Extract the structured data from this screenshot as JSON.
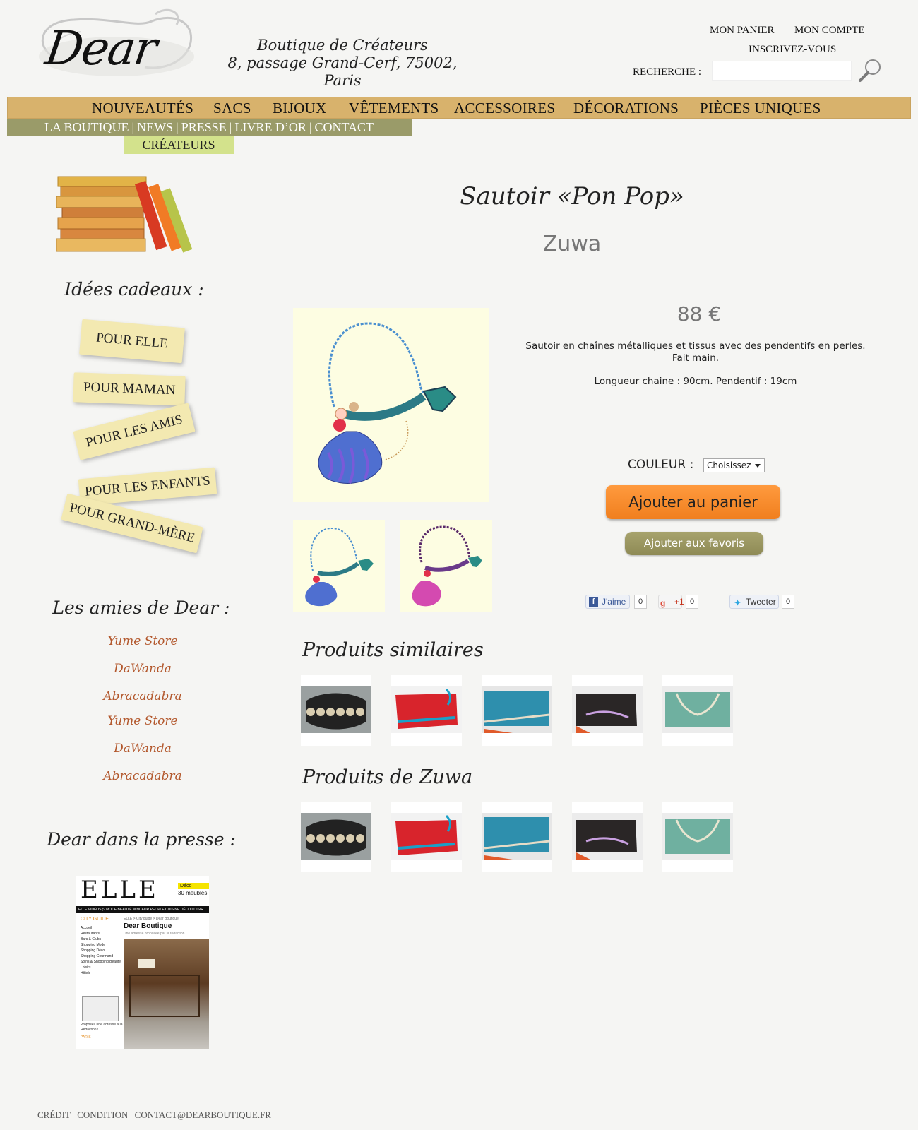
{
  "header": {
    "logo_text": "Dear",
    "tagline_1": "Boutique de Créateurs",
    "tagline_2": "8, passage Grand-Cerf, 75002, Paris",
    "my_cart": "MON PANIER",
    "my_account": "MON COMPTE",
    "register": "INSCRIVEZ-VOUS",
    "search_label": "RECHERCHE :",
    "search_value": ""
  },
  "nav": {
    "main": [
      "NOUVEAUTÉS",
      "SACS",
      "BIJOUX",
      "VÊTEMENTS",
      "ACCESSOIRES",
      "DÉCORATIONS",
      "PIÈCES UNIQUES"
    ],
    "sub": [
      "LA BOUTIQUE",
      "NEWS",
      "PRESSE",
      "LIVRE D’OR",
      "CONTACT"
    ],
    "sub_separator": "|",
    "createurs": "CRÉATEURS"
  },
  "sidebar": {
    "gifts_title": "Idées cadeaux :",
    "gift_tags": [
      "POUR ELLE",
      "POUR MAMAN",
      "POUR LES AMIS",
      "POUR LES ENFANTS",
      "POUR GRAND-MÈRE"
    ],
    "friends_title": "Les amies de Dear :",
    "friends": [
      "Yume Store",
      "DaWanda",
      "Abracadabra",
      "Yume Store",
      "DaWanda",
      "Abracadabra"
    ],
    "press_title": "Dear dans la presse :",
    "press_clip": {
      "magazine": "ELLE",
      "badge_1": "Déco",
      "badge_2": "30 meubles i",
      "menu": "ELLE VIDÉOS ▷  MODE  BEAUTÉ  MINCEUR  PEOPLE  CUISINE  DÉCO  LOISIR",
      "guide_title": "CITY GUIDE",
      "guide_items": [
        "Accueil",
        "Restaurants",
        "Bars & Clubs",
        "Shopping Mode",
        "Shopping Déco",
        "Shopping Gourmand",
        "Soins & Shopping Beauté",
        "Loisirs",
        "Hôtels"
      ],
      "crumb": "ELLE > City guide > Dear Boutique",
      "headline": "Dear Boutique",
      "sub": "Une adresse proposée par la rédaction",
      "footer_note": "Proposez une adresse à la Rédaction !",
      "city": "PARIS"
    }
  },
  "product": {
    "title": "Sautoir «Pon Pop»",
    "brand": "Zuwa",
    "price": "88 €",
    "description_1": "Sautoir en chaînes métalliques et tissus avec des pendentifs en perles.",
    "description_2": "Fait main.",
    "length": "Longueur chaine : 90cm. Pendentif : 19cm",
    "color_label": "COULEUR :",
    "color_selected": "Choisissez",
    "add_to_cart": "Ajouter au panier",
    "add_to_favorites": "Ajouter aux favoris"
  },
  "social": {
    "like_label": "J'aime",
    "like_count": "0",
    "plus_label": "+1",
    "plus_count": "0",
    "tweet_label": "Tweeter",
    "tweet_count": "0"
  },
  "similar_title": "Produits similaires",
  "brand_products_title": "Produits de Zuwa",
  "grid_items": [
    "black-necklace",
    "red-pouch",
    "blue-pouch",
    "black-pouch",
    "green-pouch"
  ],
  "footer": {
    "credit": "CRÉDIT",
    "condition": "CONDITION",
    "contact": "CONTACT@DEARBOUTIQUE.FR"
  },
  "colors": {
    "nav_gold": "#d8b26c",
    "subnav_olive": "#9a9b69",
    "createurs_lime": "#d3e28c",
    "cart_orange": "#f5892c",
    "fav_olive": "#9a9660",
    "friend_link": "#b3582d"
  }
}
